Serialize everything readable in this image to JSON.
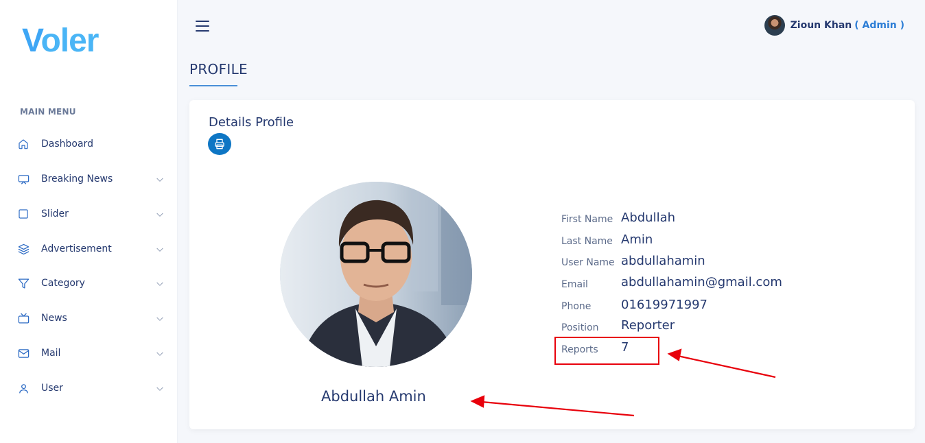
{
  "app": {
    "logo_first": "V",
    "logo_rest": "oler",
    "brand_color": "#3ea6f5"
  },
  "sidebar": {
    "section_title": "MAIN MENU",
    "items": [
      {
        "label": "Dashboard",
        "icon": "home-icon",
        "has_submenu": false
      },
      {
        "label": "Breaking News",
        "icon": "monitor-icon",
        "has_submenu": true
      },
      {
        "label": "Slider",
        "icon": "square-icon",
        "has_submenu": true
      },
      {
        "label": "Advertisement",
        "icon": "layers-icon",
        "has_submenu": true
      },
      {
        "label": "Category",
        "icon": "filter-icon",
        "has_submenu": true
      },
      {
        "label": "News",
        "icon": "tv-icon",
        "has_submenu": true
      },
      {
        "label": "Mail",
        "icon": "mail-icon",
        "has_submenu": true
      },
      {
        "label": "User",
        "icon": "user-icon",
        "has_submenu": true
      }
    ]
  },
  "header": {
    "menu_icon": "hamburger-icon",
    "user_name": "Zioun Khan",
    "user_role": "( Admin )"
  },
  "page": {
    "title": "PROFILE"
  },
  "card": {
    "title": "Details Profile",
    "print_icon": "printer-icon",
    "full_name": "Abdullah Amin",
    "fields": [
      {
        "label": "First Name",
        "value": "Abdullah"
      },
      {
        "label": "Last Name",
        "value": "Amin"
      },
      {
        "label": "User Name",
        "value": "abdullahamin"
      },
      {
        "label": "Email",
        "value": "abdullahamin@gmail.com"
      },
      {
        "label": "Phone",
        "value": "01619971997"
      },
      {
        "label": "Position",
        "value": "Reporter"
      },
      {
        "label": "Reports",
        "value": "7"
      }
    ]
  },
  "colors": {
    "accent": "#2d7ed6",
    "print_button": "#0e76c4",
    "annotation_red": "#e8000b",
    "text": "#25396f"
  }
}
